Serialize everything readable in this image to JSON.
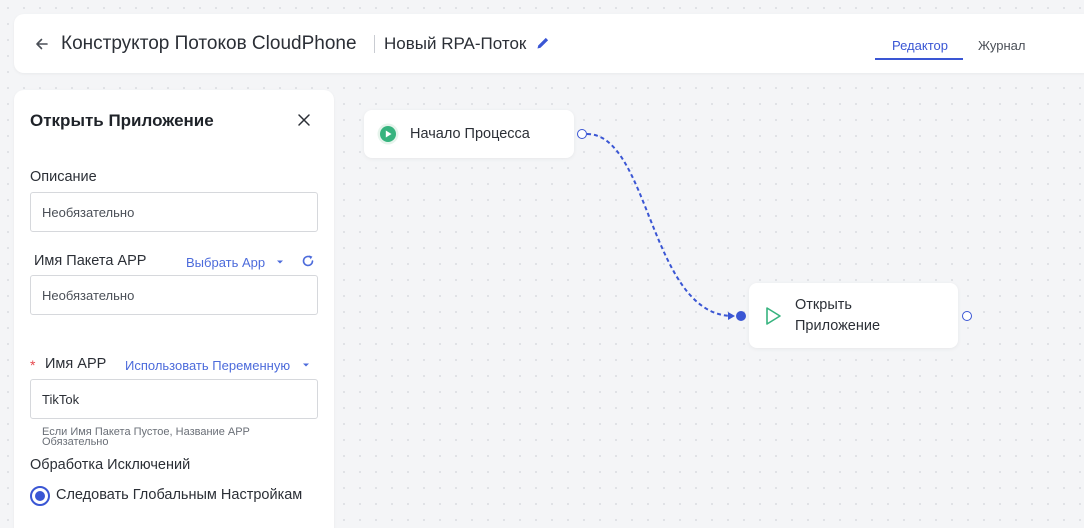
{
  "header": {
    "app_title": "Конструктор Потоков CloudPhone",
    "flow_name": "Новый RPA-Поток",
    "tabs": [
      {
        "label": "Редактор",
        "active": true
      },
      {
        "label": "Журнал",
        "active": false
      }
    ]
  },
  "panel": {
    "title": "Открыть Приложение",
    "description": {
      "label": "Описание",
      "placeholder": "Необязательно",
      "value": ""
    },
    "package": {
      "label": "Имя Пакета APP",
      "select_label": "Выбрать App",
      "placeholder": "Необязательно",
      "value": ""
    },
    "app_name": {
      "required_mark": "*",
      "label": "Имя APP",
      "variable_label": "Использовать Переменную",
      "value": "TikTok",
      "hint": "Если Имя Пакета Пустое, Название APP Обязательно"
    },
    "exception": {
      "label": "Обработка Исключений",
      "option": "Следовать Глобальным Настройкам",
      "selected": true
    }
  },
  "canvas": {
    "nodes": [
      {
        "id": "start",
        "label": "Начало Процесса",
        "icon": "play-circle-icon"
      },
      {
        "id": "open-app",
        "label_line1": "Открыть",
        "label_line2": "Приложение",
        "icon": "play-outline-icon"
      }
    ]
  },
  "colors": {
    "accent": "#3a56d4",
    "start_green": "#36b37e",
    "required": "#e5484d"
  }
}
